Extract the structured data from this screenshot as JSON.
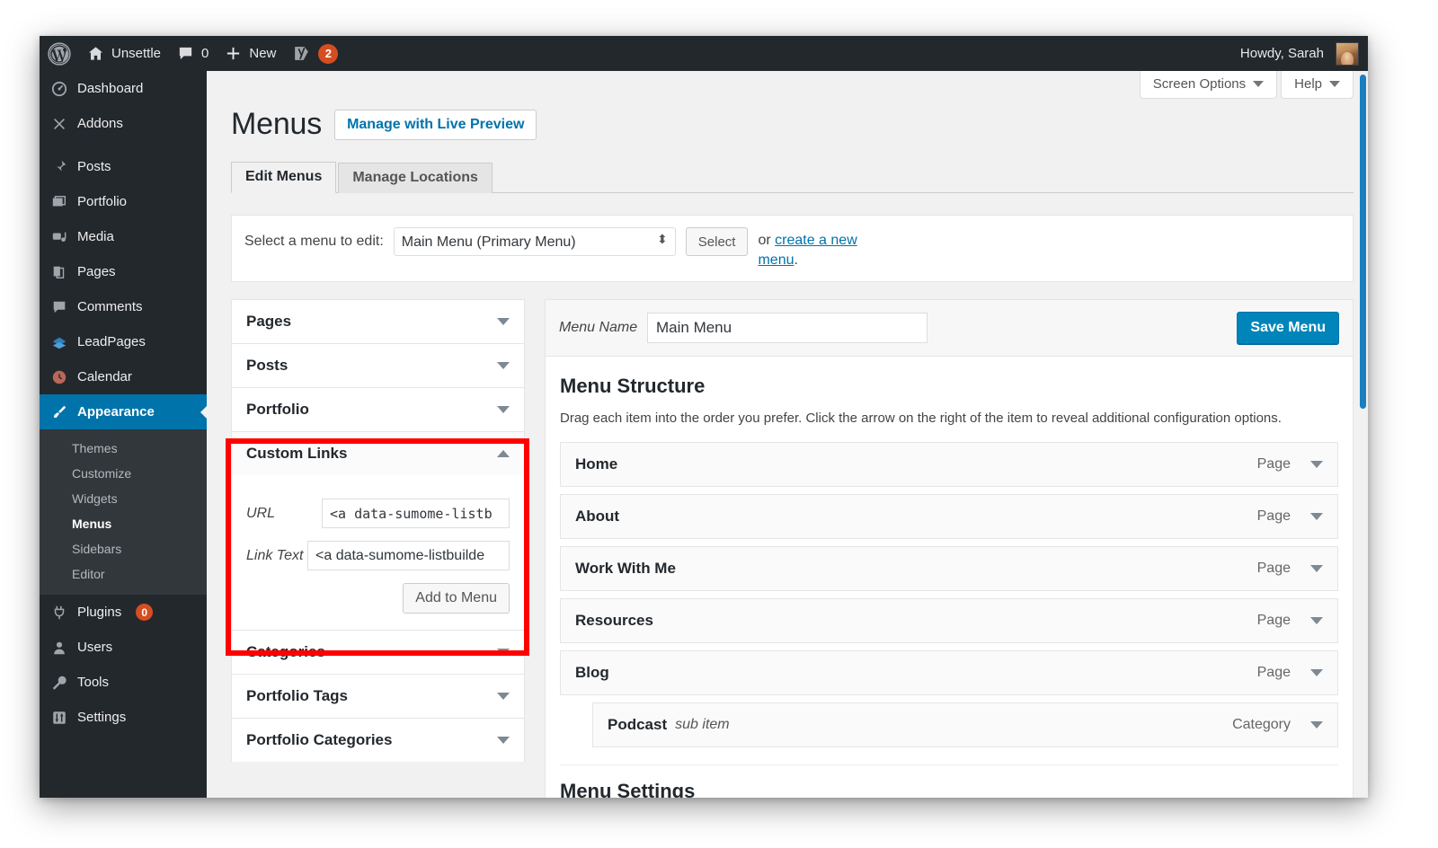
{
  "adminbar": {
    "logo_icon": "wordpress-logo-icon",
    "site_name": "Unsettle",
    "comments_count": "0",
    "new_label": "New",
    "yoast_label": "Yoast SEO",
    "yoast_count": "2",
    "howdy": "Howdy, Sarah"
  },
  "sidebar": {
    "items": [
      {
        "label": "Dashboard",
        "icon": "dashboard-icon"
      },
      {
        "label": "Addons",
        "icon": "addons-x-icon"
      },
      {
        "label": "Posts",
        "icon": "pin-icon"
      },
      {
        "label": "Portfolio",
        "icon": "portfolio-images-icon"
      },
      {
        "label": "Media",
        "icon": "media-camera-icon"
      },
      {
        "label": "Pages",
        "icon": "pages-icon"
      },
      {
        "label": "Comments",
        "icon": "comment-bubble-icon"
      },
      {
        "label": "LeadPages",
        "icon": "leadpages-icon"
      },
      {
        "label": "Calendar",
        "icon": "calendar-icon"
      },
      {
        "label": "Appearance",
        "icon": "paintbrush-icon"
      },
      {
        "label": "Plugins",
        "icon": "plug-icon",
        "count": "0"
      },
      {
        "label": "Users",
        "icon": "user-icon"
      },
      {
        "label": "Tools",
        "icon": "wrench-icon"
      },
      {
        "label": "Settings",
        "icon": "settings-sliders-icon"
      }
    ],
    "appearance_submenu": [
      "Themes",
      "Customize",
      "Widgets",
      "Menus",
      "Sidebars",
      "Editor"
    ],
    "current_top": "Appearance",
    "current_sub": "Menus"
  },
  "screen_meta": {
    "screen_options": "Screen Options",
    "help": "Help"
  },
  "page": {
    "title": "Menus",
    "live_preview_button": "Manage with Live Preview",
    "tabs": [
      {
        "label": "Edit Menus",
        "active": true
      },
      {
        "label": "Manage Locations",
        "active": false
      }
    ]
  },
  "menu_select": {
    "label": "Select a menu to edit:",
    "value": "Main Menu (Primary Menu)",
    "options": [
      "Main Menu (Primary Menu)"
    ],
    "select_button": "Select",
    "or_text": "or ",
    "create_link": "create a new menu",
    "period": "."
  },
  "accordion": {
    "sections": [
      {
        "title": "Pages",
        "open": false
      },
      {
        "title": "Posts",
        "open": false
      },
      {
        "title": "Portfolio",
        "open": false
      },
      {
        "title": "Custom Links",
        "open": true
      },
      {
        "title": "Categories",
        "open": false
      },
      {
        "title": "Portfolio Tags",
        "open": false
      },
      {
        "title": "Portfolio Categories",
        "open": false
      }
    ],
    "custom_links": {
      "url_label": "URL",
      "url_value": "<a data-sumome-listb",
      "link_text_label": "Link Text",
      "link_text_value": "<a data-sumome-listbuilde",
      "add_button": "Add to Menu"
    },
    "highlight_color": "#ff0000"
  },
  "menu_edit": {
    "menu_name_label": "Menu Name",
    "menu_name_value": "Main Menu",
    "save_button": "Save Menu",
    "structure_title": "Menu Structure",
    "structure_desc": "Drag each item into the order you prefer. Click the arrow on the right of the item to reveal additional configuration options.",
    "items": [
      {
        "title": "Home",
        "type": "Page",
        "sub": false,
        "note": ""
      },
      {
        "title": "About",
        "type": "Page",
        "sub": false,
        "note": ""
      },
      {
        "title": "Work With Me",
        "type": "Page",
        "sub": false,
        "note": ""
      },
      {
        "title": "Resources",
        "type": "Page",
        "sub": false,
        "note": ""
      },
      {
        "title": "Blog",
        "type": "Page",
        "sub": false,
        "note": ""
      },
      {
        "title": "Podcast",
        "type": "Category",
        "sub": true,
        "note": "sub item"
      }
    ],
    "settings_title": "Menu Settings"
  },
  "colors": {
    "admin_dark": "#23282d",
    "admin_submenu": "#32373c",
    "accent_blue": "#0073aa",
    "save_blue": "#0085ba",
    "badge_orange": "#d54e21",
    "highlight_red": "#ff0000"
  }
}
